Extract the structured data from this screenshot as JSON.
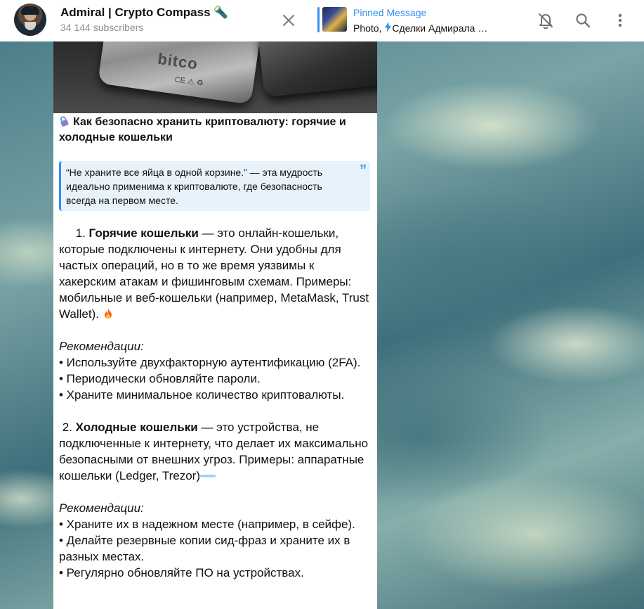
{
  "header": {
    "channel_title": "Admiral | Crypto Compass",
    "title_emoji": "🔦",
    "subscribers": "34 144 subscribers",
    "pinned_title": "Pinned Message",
    "pinned_prefix": "Photo, ",
    "pinned_text": "Сделки Адмирала …"
  },
  "icons": {
    "close": "close-icon",
    "mute": "bell-off-icon",
    "search": "search-icon",
    "menu": "more-vertical-icon"
  },
  "message": {
    "photo_engraving": "bitco",
    "photo_marks": "CE ⚠ ♻",
    "heading": "Как безопасно хранить криптовалюту: горячие и холодные кошельки",
    "quote": "“Не храните все яйца в одной корзине.” — эта мудрость идеально применима к криптовалюте, где безопасность всегда на первом месте.",
    "quote_mark": "”",
    "hot_title": "Горячие кошельки",
    "hot_prefix": "     1. ",
    "hot_text": " — это онлайн-кошельки, которые подключены к интернету. Они удобны для частых операций, но в то же время уязвимы к хакерским атакам и фишинговым схемам. Примеры: мобильные и веб-кошельки (например, MetaMask, Trust Wallet). ",
    "rec_label": "Рекомендации:",
    "hot_recs": [
      " • Используйте двухфакторную аутентификацию (2FA).",
      " • Периодически обновляйте пароли.",
      " • Храните минимальное количество криптовалюты."
    ],
    "cold_prefix": " 2. ",
    "cold_title": "Холодные кошельки",
    "cold_text": " — это устройства, не подключенные к интернету, что делает их максимально безопасными от внешних угроз. Примеры: аппаратные кошельки (Ledger, Trezor)",
    "cold_recs": [
      " • Храните их в надежном месте (например, в сейфе).",
      " • Делайте резервные копии сид-фраз и храните их в разных местах.",
      " • Регулярно обновляйте ПО на устройствах."
    ]
  }
}
